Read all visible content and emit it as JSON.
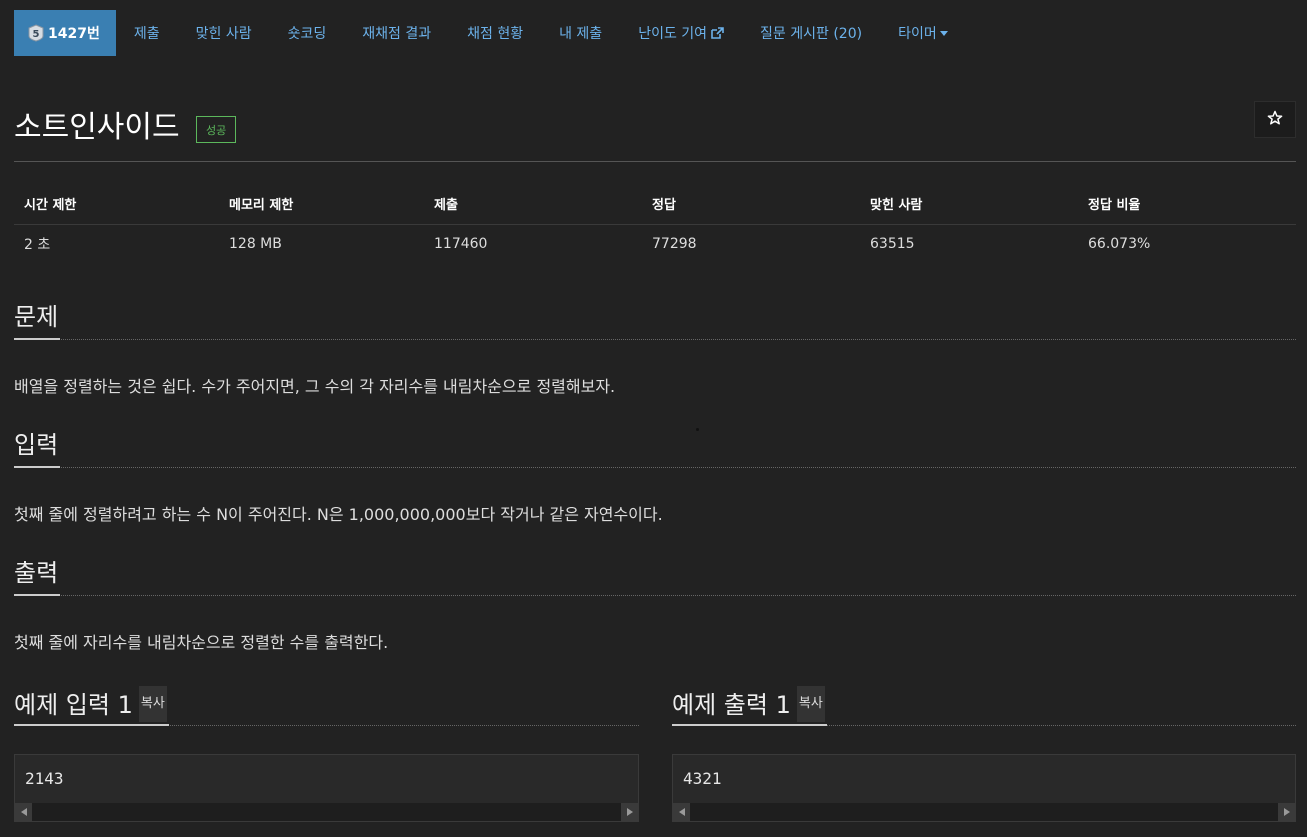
{
  "nav": {
    "problem_number": "1427번",
    "tier_level": "5",
    "items": [
      {
        "label": "제출"
      },
      {
        "label": "맞힌 사람"
      },
      {
        "label": "숏코딩"
      },
      {
        "label": "재채점 결과"
      },
      {
        "label": "채점 현황"
      },
      {
        "label": "내 제출"
      },
      {
        "label": "난이도 기여"
      },
      {
        "label": "질문 게시판 (20)"
      },
      {
        "label": "타이머"
      }
    ],
    "colors": {
      "active_bg": "#3a7fb2",
      "link": "#6cb2eb"
    }
  },
  "problem": {
    "title": "소트인사이드",
    "status": "성공",
    "status_color": "#5cb85c"
  },
  "info": {
    "headers": [
      "시간 제한",
      "메모리 제한",
      "제출",
      "정답",
      "맞힌 사람",
      "정답 비율"
    ],
    "values": [
      "2 초",
      "128 MB",
      "117460",
      "77298",
      "63515",
      "66.073%"
    ]
  },
  "sections": {
    "problem": {
      "heading": "문제",
      "text": "배열을 정렬하는 것은 쉽다. 수가 주어지면, 그 수의 각 자리수를 내림차순으로 정렬해보자."
    },
    "input": {
      "heading": "입력",
      "text": "첫째 줄에 정렬하려고 하는 수 N이 주어진다. N은 1,000,000,000보다 작거나 같은 자연수이다."
    },
    "output": {
      "heading": "출력",
      "text": "첫째 줄에 자리수를 내림차순으로 정렬한 수를 출력한다."
    }
  },
  "samples": {
    "input": {
      "heading": "예제 입력 1",
      "copy": "복사",
      "value": "2143"
    },
    "output": {
      "heading": "예제 출력 1",
      "copy": "복사",
      "value": "4321"
    }
  }
}
